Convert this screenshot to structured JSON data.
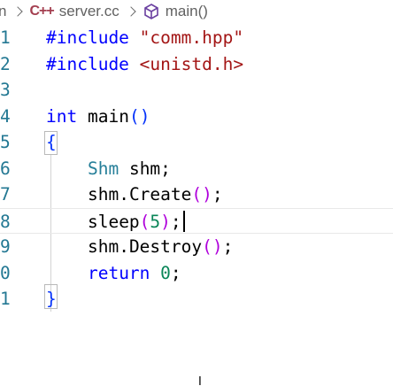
{
  "breadcrumb": {
    "prev_fragment": "n",
    "file_lang_icon": "C++",
    "file_name": "server.cc",
    "symbol_icon": "cube-icon",
    "symbol_name": "main()"
  },
  "editor": {
    "lines": [
      {
        "number": "1"
      },
      {
        "number": "2"
      },
      {
        "number": "3"
      },
      {
        "number": "4"
      },
      {
        "number": "5"
      },
      {
        "number": "6"
      },
      {
        "number": "7"
      },
      {
        "number": "8"
      },
      {
        "number": "9"
      },
      {
        "number": "0"
      },
      {
        "number": "1"
      }
    ],
    "tokens": {
      "l1_directive": "#include",
      "l1_header": "\"comm.hpp\"",
      "l2_directive": "#include",
      "l2_header": "<unistd.h>",
      "l4_type": "int",
      "l4_name": "main",
      "l4_parens": "()",
      "l5_brace_open": "{",
      "l6_class": "Shm",
      "l6_rest": "shm;",
      "l7_obj": "shm.",
      "l7_fn": "Create",
      "l7_parens": "()",
      "l7_semi": ";",
      "l8_fn": "sleep",
      "l8_paren_open": "(",
      "l8_num": "5",
      "l8_paren_close": ")",
      "l8_semi": ";",
      "l9_obj": "shm.",
      "l9_fn": "Destroy",
      "l9_parens": "()",
      "l9_semi": ";",
      "l10_kw": "return",
      "l10_num": "0",
      "l10_semi": ";",
      "l11_brace_close": "}"
    }
  },
  "colors": {
    "line_number": "#237893",
    "keyword": "#0000ff",
    "control": "#af00db",
    "string": "#a31515",
    "number": "#098658",
    "class": "#267f99",
    "function": "#795e26"
  }
}
